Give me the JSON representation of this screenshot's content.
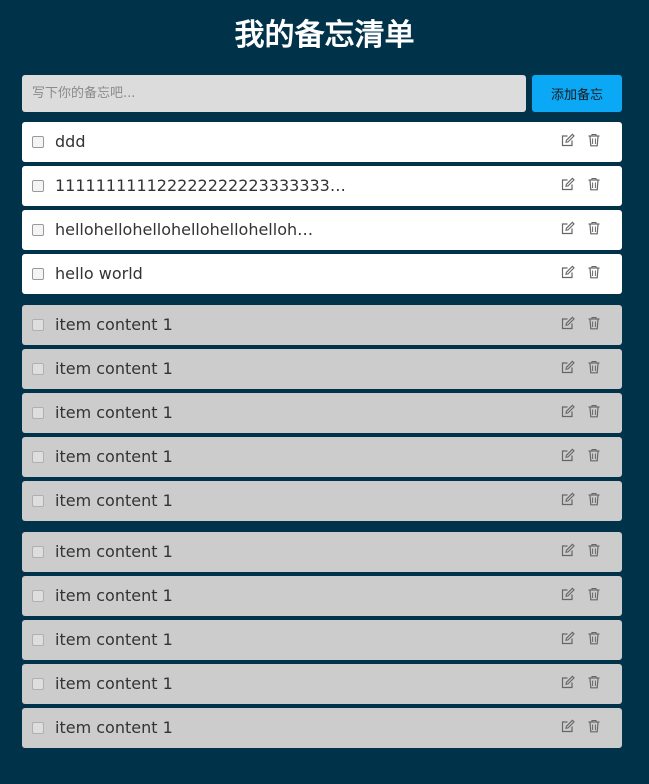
{
  "title": "我的备忘清单",
  "input": {
    "placeholder": "写下你的备忘吧...",
    "value": ""
  },
  "add_button_label": "添加备忘",
  "icons": {
    "edit": "edit-icon",
    "delete": "trash-icon"
  },
  "colors": {
    "background": "#00334a",
    "accent": "#0aa8f5",
    "active_item": "#ffffff",
    "done_item": "#cccccc"
  },
  "active_items": [
    {
      "text": "ddd",
      "checked": false
    },
    {
      "text": "11111111112222222222333333333…",
      "checked": false
    },
    {
      "text": "hellohellohellohellohellohelloh…",
      "checked": false
    },
    {
      "text": "hello world",
      "checked": false
    }
  ],
  "done_items_group1": [
    {
      "text": "item content 1"
    },
    {
      "text": "item content 1"
    },
    {
      "text": "item content 1"
    },
    {
      "text": "item content 1"
    },
    {
      "text": "item content 1"
    }
  ],
  "done_items_group2": [
    {
      "text": "item content 1"
    },
    {
      "text": "item content 1"
    },
    {
      "text": "item content 1"
    },
    {
      "text": "item content 1"
    },
    {
      "text": "item content 1"
    }
  ]
}
